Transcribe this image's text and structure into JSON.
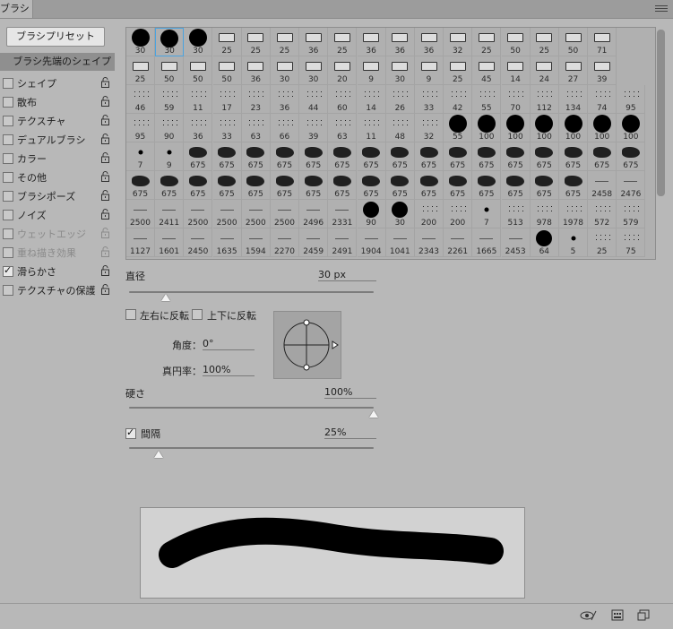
{
  "tab": {
    "label": "ブラシ"
  },
  "preset_button": "ブラシプリセット",
  "section_header": "ブラシ先端のシェイプ",
  "options": [
    {
      "label": "シェイプ",
      "checked": false,
      "disabled": false
    },
    {
      "label": "散布",
      "checked": false,
      "disabled": false
    },
    {
      "label": "テクスチャ",
      "checked": false,
      "disabled": false
    },
    {
      "label": "デュアルブラシ",
      "checked": false,
      "disabled": false
    },
    {
      "label": "カラー",
      "checked": false,
      "disabled": false
    },
    {
      "label": "その他",
      "checked": false,
      "disabled": false
    },
    {
      "label": "ブラシポーズ",
      "checked": false,
      "disabled": false
    },
    {
      "label": "ノイズ",
      "checked": false,
      "disabled": false
    },
    {
      "label": "ウェットエッジ",
      "checked": false,
      "disabled": true
    },
    {
      "label": "重ね描き効果",
      "checked": false,
      "disabled": true
    },
    {
      "label": "滑らかさ",
      "checked": true,
      "disabled": false
    },
    {
      "label": "テクスチャの保護",
      "checked": false,
      "disabled": false
    }
  ],
  "brush_sizes": [
    [
      "30",
      "30",
      "30",
      "25",
      "25",
      "25",
      "36",
      "25",
      "36",
      "36",
      "36",
      "32",
      "25",
      "50",
      "25",
      "50",
      "71"
    ],
    [
      "25",
      "50",
      "50",
      "50",
      "36",
      "30",
      "30",
      "20",
      "9",
      "30",
      "9",
      "25",
      "45",
      "14",
      "24",
      "27",
      "39"
    ],
    [
      "46",
      "59",
      "11",
      "17",
      "23",
      "36",
      "44",
      "60",
      "14",
      "26",
      "33",
      "42",
      "55",
      "70",
      "112",
      "134",
      "74",
      "95"
    ],
    [
      "95",
      "90",
      "36",
      "33",
      "63",
      "66",
      "39",
      "63",
      "11",
      "48",
      "32",
      "55",
      "100",
      "100",
      "100",
      "100",
      "100",
      "100"
    ],
    [
      "7",
      "9",
      "675",
      "675",
      "675",
      "675",
      "675",
      "675",
      "675",
      "675",
      "675",
      "675",
      "675",
      "675",
      "675",
      "675",
      "675",
      "675"
    ],
    [
      "675",
      "675",
      "675",
      "675",
      "675",
      "675",
      "675",
      "675",
      "675",
      "675",
      "675",
      "675",
      "675",
      "675",
      "675",
      "675",
      "2458",
      "2476"
    ],
    [
      "2500",
      "2411",
      "2500",
      "2500",
      "2500",
      "2500",
      "2496",
      "2331",
      "90",
      "30",
      "200",
      "200",
      "7",
      "513",
      "978",
      "1978",
      "572",
      "579"
    ],
    [
      "1127",
      "1601",
      "2450",
      "1635",
      "1594",
      "2270",
      "2459",
      "2491",
      "1904",
      "1041",
      "2343",
      "2261",
      "1665",
      "2453",
      "64",
      "5",
      "25",
      "75"
    ]
  ],
  "diameter": {
    "label": "直径",
    "value": "30 px",
    "slider_fraction": 0.15
  },
  "flip_x": {
    "label": "左右に反転",
    "checked": false
  },
  "flip_y": {
    "label": "上下に反転",
    "checked": false
  },
  "angle": {
    "label": "角度：",
    "value": "0°"
  },
  "roundness": {
    "label": "真円率：",
    "value": "100%"
  },
  "hardness": {
    "label": "硬さ",
    "value": "100%",
    "slider_fraction": 1.0
  },
  "spacing": {
    "label": "間隔",
    "value": "25%",
    "checked": true,
    "slider_fraction": 0.12
  }
}
